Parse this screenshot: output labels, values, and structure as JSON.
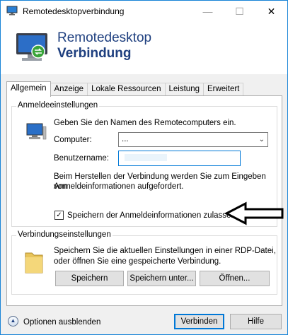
{
  "window": {
    "title": "Remotedesktopverbindung",
    "minimize_glyph": "—",
    "maximize_glyph": "☐",
    "close_glyph": "✕"
  },
  "banner": {
    "line1": "Remotedesktop",
    "line2": "Verbindung"
  },
  "tabs": [
    {
      "label": "Allgemein",
      "active": true
    },
    {
      "label": "Anzeige",
      "active": false
    },
    {
      "label": "Lokale Ressourcen",
      "active": false
    },
    {
      "label": "Leistung",
      "active": false
    },
    {
      "label": "Erweitert",
      "active": false
    }
  ],
  "logon_group": {
    "title": "Anmeldeeinstellungen",
    "instruction": "Geben Sie den Namen des Remotecomputers ein.",
    "computer_label": "Computer:",
    "computer_value": "...",
    "username_label": "Benutzername:",
    "username_value": "",
    "info_line1": "Beim Herstellen der Verbindung werden Sie zum Eingeben von",
    "info_line2": "Anmeldeinformationen aufgefordert.",
    "save_credentials_label": "Speichern der Anmeldeinformationen zulassen",
    "save_credentials_checked": true
  },
  "connection_group": {
    "title": "Verbindungseinstellungen",
    "text_line1": "Speichern Sie die aktuellen Einstellungen in einer RDP-Datei,",
    "text_line2": "oder öffnen Sie eine gespeicherte Verbindung.",
    "save_label": "Speichern",
    "save_as_label": "Speichern unter...",
    "open_label": "Öffnen..."
  },
  "footer": {
    "options_label": "Optionen ausblenden",
    "connect_label": "Verbinden",
    "help_label": "Hilfe"
  },
  "colors": {
    "banner_text": "#1e3f7f",
    "focus_border": "#0078d7",
    "window_border": "#1883d7"
  }
}
